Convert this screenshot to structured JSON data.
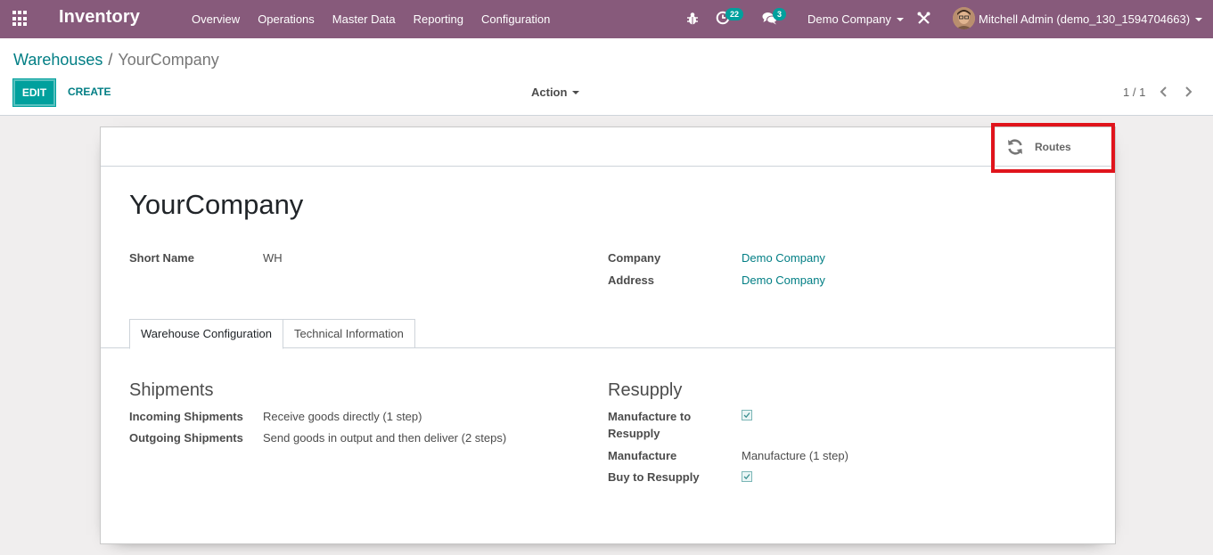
{
  "navbar": {
    "app_title": "Inventory",
    "menu": [
      "Overview",
      "Operations",
      "Master Data",
      "Reporting",
      "Configuration"
    ],
    "activity_count": "22",
    "message_count": "3",
    "company": "Demo Company",
    "user": "Mitchell Admin (demo_130_1594704663)"
  },
  "breadcrumb": {
    "parent": "Warehouses",
    "separator": "/",
    "current": "YourCompany"
  },
  "buttons": {
    "edit": "EDIT",
    "create": "CREATE",
    "action": "Action"
  },
  "pager": "1 / 1",
  "smart_button": {
    "label": "Routes",
    "icon": "refresh-icon"
  },
  "form": {
    "name": "YourCompany",
    "short_name_label": "Short Name",
    "short_name_value": "WH",
    "company_label": "Company",
    "company_value": "Demo Company",
    "address_label": "Address",
    "address_value": "Demo Company"
  },
  "tabs": [
    "Warehouse Configuration",
    "Technical Information"
  ],
  "shipments": {
    "title": "Shipments",
    "incoming_label": "Incoming Shipments",
    "incoming_value": "Receive goods directly (1 step)",
    "outgoing_label": "Outgoing Shipments",
    "outgoing_value": "Send goods in output and then deliver (2 steps)"
  },
  "resupply": {
    "title": "Resupply",
    "manufacture_to_resupply_label_line1": "Manufacture to",
    "manufacture_to_resupply_label_line2": "Resupply",
    "manufacture_to_resupply_checked": true,
    "manufacture_label": "Manufacture",
    "manufacture_value": "Manufacture (1 step)",
    "buy_to_resupply_label": "Buy to Resupply",
    "buy_to_resupply_checked": true
  },
  "colors": {
    "navbar": "#875a7b",
    "primary": "#00a09d",
    "link": "#017e84",
    "highlight": "#e0141c"
  }
}
